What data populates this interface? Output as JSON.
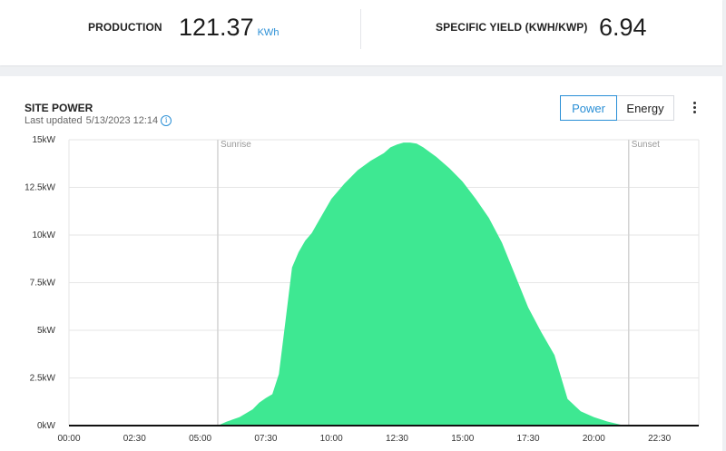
{
  "summary": {
    "production_label": "PRODUCTION",
    "production_value": "121.37",
    "production_unit": "KWh",
    "yield_label": "SPECIFIC YIELD (KWH/KWP)",
    "yield_value": "6.94"
  },
  "site_power": {
    "title": "SITE POWER",
    "last_updated_label": "Last updated",
    "last_updated_value": "5/13/2023 12:14",
    "info_icon": "info-icon",
    "toggle": {
      "power_label": "Power",
      "energy_label": "Energy",
      "active": "power"
    },
    "menu_icon": "vertical-dots-icon"
  },
  "colors": {
    "area": "#3ee892",
    "accent": "#2a8fd6"
  },
  "chart_data": {
    "type": "area",
    "x_unit": "hours",
    "xlim": [
      0,
      24
    ],
    "ylim": [
      0,
      15
    ],
    "yticks": [
      {
        "v": 0,
        "label": "0kW"
      },
      {
        "v": 2.5,
        "label": "2.5kW"
      },
      {
        "v": 5,
        "label": "5kW"
      },
      {
        "v": 7.5,
        "label": "7.5kW"
      },
      {
        "v": 10,
        "label": "10kW"
      },
      {
        "v": 12.5,
        "label": "12.5kW"
      },
      {
        "v": 15,
        "label": "15kW"
      }
    ],
    "xticks": [
      {
        "v": 0,
        "label": "00:00"
      },
      {
        "v": 2.5,
        "label": "02:30"
      },
      {
        "v": 5,
        "label": "05:00"
      },
      {
        "v": 7.5,
        "label": "07:30"
      },
      {
        "v": 10,
        "label": "10:00"
      },
      {
        "v": 12.5,
        "label": "12:30"
      },
      {
        "v": 15,
        "label": "15:00"
      },
      {
        "v": 17.5,
        "label": "17:30"
      },
      {
        "v": 20,
        "label": "20:00"
      },
      {
        "v": 22.5,
        "label": "22:30"
      }
    ],
    "markers": [
      {
        "name": "Sunrise",
        "x": 5.67
      },
      {
        "name": "Sunset",
        "x": 21.33
      }
    ],
    "grid": true,
    "x": [
      0,
      5.67,
      6.0,
      6.5,
      7.0,
      7.25,
      7.5,
      7.75,
      8.0,
      8.25,
      8.5,
      8.75,
      9.0,
      9.25,
      9.5,
      9.75,
      10.0,
      10.5,
      11.0,
      11.5,
      12.0,
      12.25,
      12.5,
      12.75,
      13.0,
      13.25,
      13.5,
      14.0,
      14.5,
      15.0,
      15.5,
      16.0,
      16.5,
      17.0,
      17.5,
      18.0,
      18.5,
      19.0,
      19.5,
      20.0,
      20.5,
      21.0,
      21.33,
      24
    ],
    "y": [
      0,
      0,
      0.2,
      0.45,
      0.85,
      1.2,
      1.45,
      1.65,
      2.7,
      5.5,
      8.3,
      9.1,
      9.7,
      10.1,
      10.7,
      11.3,
      11.9,
      12.7,
      13.4,
      13.9,
      14.3,
      14.6,
      14.75,
      14.85,
      14.85,
      14.8,
      14.6,
      14.1,
      13.5,
      12.8,
      11.9,
      10.9,
      9.6,
      7.9,
      6.2,
      4.9,
      3.7,
      1.4,
      0.75,
      0.45,
      0.22,
      0.05,
      0,
      0
    ]
  }
}
